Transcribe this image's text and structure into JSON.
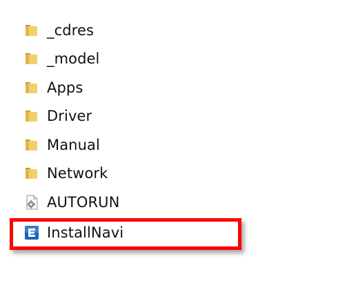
{
  "files": [
    {
      "name": "_cdres",
      "icon": "folder-icon"
    },
    {
      "name": "_model",
      "icon": "folder-icon"
    },
    {
      "name": "Apps",
      "icon": "folder-icon"
    },
    {
      "name": "Driver",
      "icon": "folder-icon"
    },
    {
      "name": "Manual",
      "icon": "folder-icon"
    },
    {
      "name": "Network",
      "icon": "folder-icon"
    },
    {
      "name": "AUTORUN",
      "icon": "settings-file-icon"
    },
    {
      "name": "InstallNavi",
      "icon": "installnavi-app-icon"
    }
  ],
  "highlight": {
    "target": "InstallNavi",
    "color": "#ff0000"
  },
  "colors": {
    "folder_back": "#c99a2e",
    "folder_front": "#f2cf6a",
    "app_icon_bg": "#1d63b8",
    "label_text": "#111111"
  }
}
